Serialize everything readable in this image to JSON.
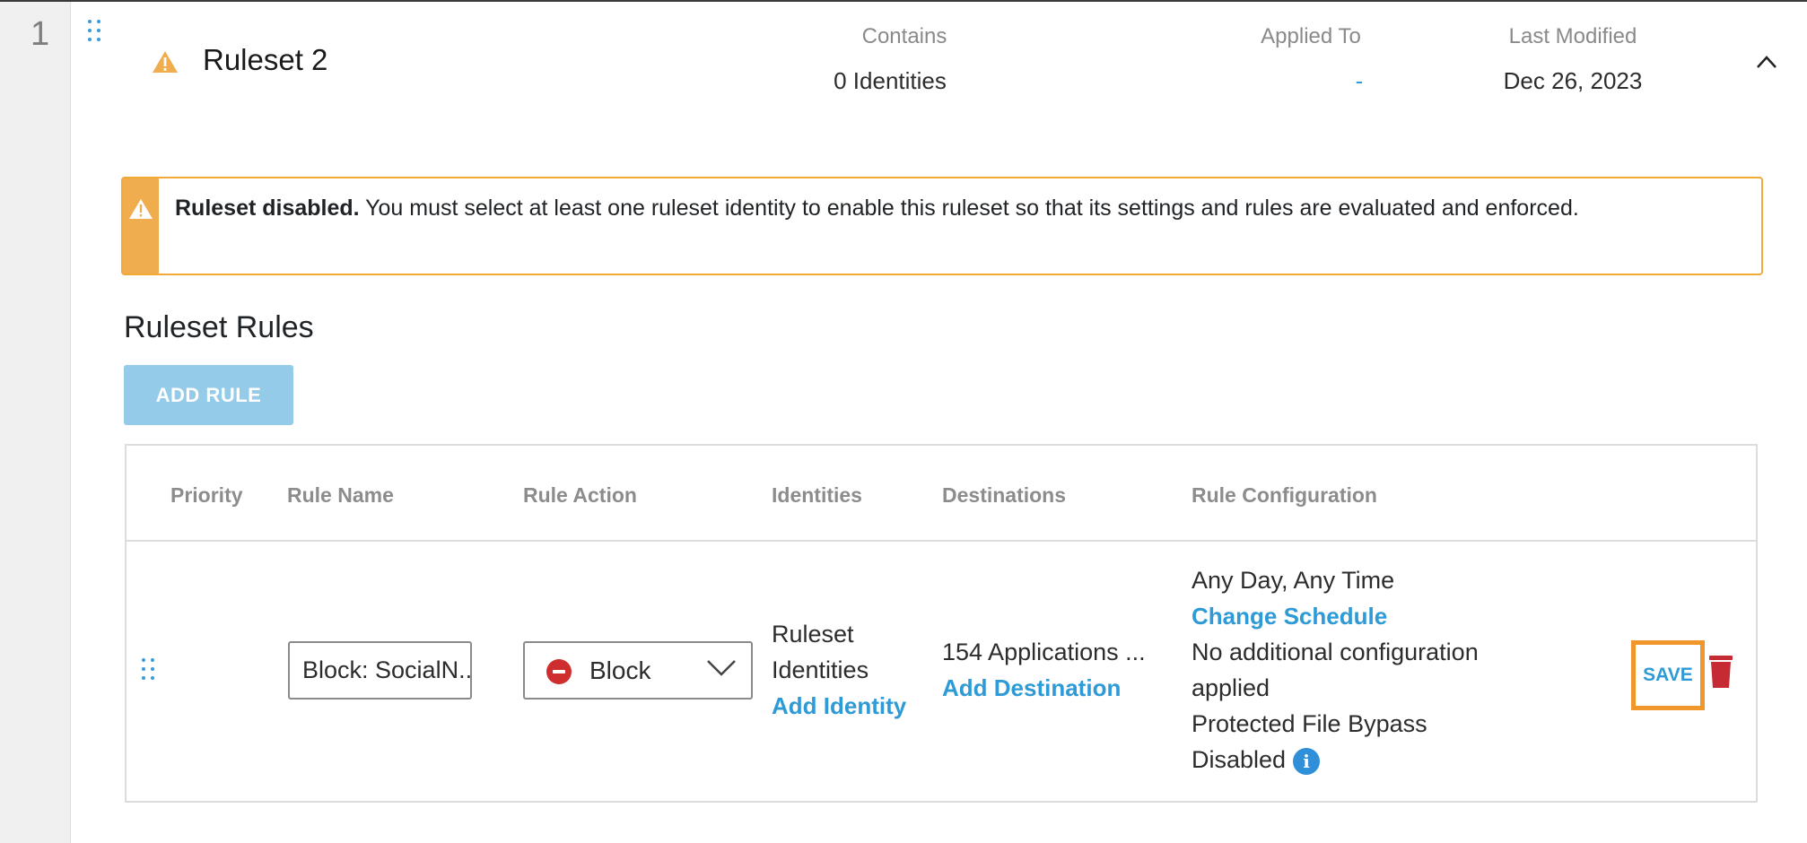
{
  "ruleset": {
    "index": "1",
    "name": "Ruleset 2",
    "contains_label": "Contains",
    "contains_value": "0 Identities",
    "applied_to_label": "Applied To",
    "applied_to_value": "-",
    "last_modified_label": "Last Modified",
    "last_modified_value": "Dec 26, 2023"
  },
  "alert": {
    "bold_text": "Ruleset disabled.",
    "message": " You must select at least one ruleset identity to enable this ruleset so that its settings and rules are evaluated and enforced."
  },
  "rules_section": {
    "title": "Ruleset Rules",
    "add_rule_label": "ADD RULE"
  },
  "table": {
    "columns": [
      "Priority",
      "Rule Name",
      "Rule Action",
      "Identities",
      "Destinations",
      "Rule Configuration"
    ],
    "row": {
      "rule_name_value": "Block: SocialN...",
      "rule_action_value": "Block",
      "identities_line1": "Ruleset",
      "identities_line2": "Identities",
      "add_identity_label": "Add Identity",
      "destinations_value": "154 Applications ...",
      "add_destination_label": "Add Destination",
      "schedule_text": "Any Day, Any Time",
      "change_schedule_label": "Change Schedule",
      "config_line1": "No additional configuration",
      "config_line2": "applied",
      "bypass_line1": "Protected File Bypass",
      "bypass_line2": "Disabled",
      "save_label": "SAVE"
    }
  },
  "icons": {
    "warning": "warning-triangle-icon",
    "collapse": "chevron-up-icon",
    "block": "block-circle-icon",
    "dropdown": "chevron-down-icon",
    "delete": "trash-icon",
    "info": "info-icon",
    "drag": "drag-handle-icon"
  },
  "colors": {
    "accent_link": "#2e9ad6",
    "warning": "#f0ad4e",
    "add_rule_bg": "#93cbe9",
    "block_red": "#cf2e2e",
    "save_highlight": "#f0962b"
  }
}
